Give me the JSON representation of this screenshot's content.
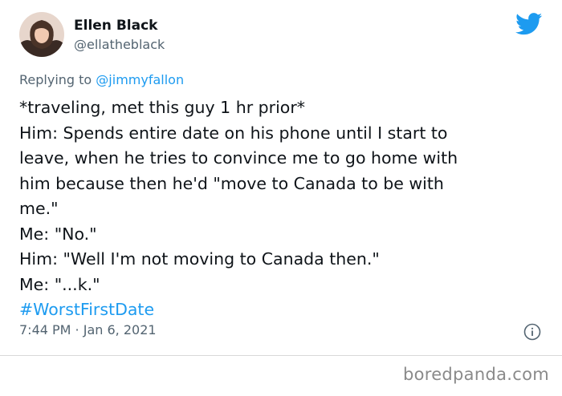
{
  "author": {
    "name": "Ellen Black",
    "handle": "@ellatheblack"
  },
  "reply": {
    "prefix": "Replying to",
    "mention": "@jimmyfallon"
  },
  "tweet": {
    "lines": [
      "*traveling, met this guy 1 hr prior*",
      "Him: Spends entire date on his phone until I start to",
      "leave, when he tries to convince me to go home with",
      "him because then he'd \"move to Canada to be with",
      "me.\"",
      "Me: \"No.\"",
      "Him: \"Well I'm not moving to Canada then.\"",
      "Me: \"...k.\""
    ],
    "hashtag": "#WorstFirstDate",
    "timestamp": "7:44 PM · Jan 6, 2021"
  },
  "icons": {
    "brand": "twitter-bird-icon",
    "info": "info-icon",
    "brand_color": "#1d9bf0"
  },
  "watermark": "boredpanda.com"
}
